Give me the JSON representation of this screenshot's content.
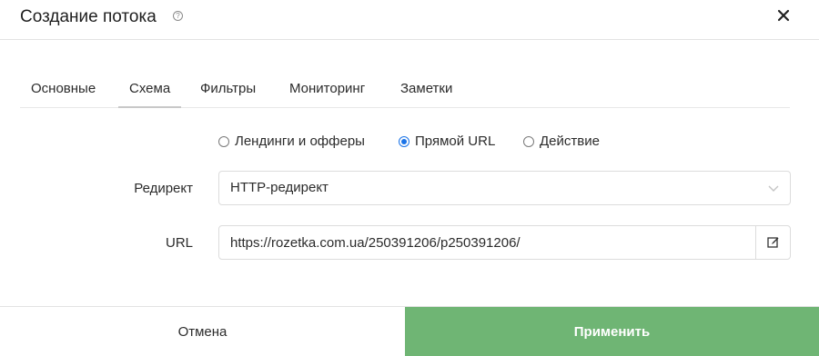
{
  "dialog": {
    "title": "Создание потока",
    "help_icon": "question-circle-icon",
    "close_icon": "close-icon"
  },
  "tabs": [
    {
      "label": "Основные",
      "active": false
    },
    {
      "label": "Схема",
      "active": true
    },
    {
      "label": "Фильтры",
      "active": false
    },
    {
      "label": "Мониторинг",
      "active": false
    },
    {
      "label": "Заметки",
      "active": false
    }
  ],
  "scheme_type": {
    "options": [
      {
        "label": "Лендинги и офферы",
        "checked": false
      },
      {
        "label": "Прямой URL",
        "checked": true
      },
      {
        "label": "Действие",
        "checked": false
      }
    ]
  },
  "redirect": {
    "label": "Редирект",
    "value": "HTTP-редирект"
  },
  "url": {
    "label": "URL",
    "value": "https://rozetka.com.ua/250391206/p250391206/",
    "edit_icon": "edit-icon"
  },
  "footer": {
    "cancel_label": "Отмена",
    "apply_label": "Применить"
  },
  "colors": {
    "accent": "#1a73e8",
    "apply_bg": "#6fb574"
  }
}
